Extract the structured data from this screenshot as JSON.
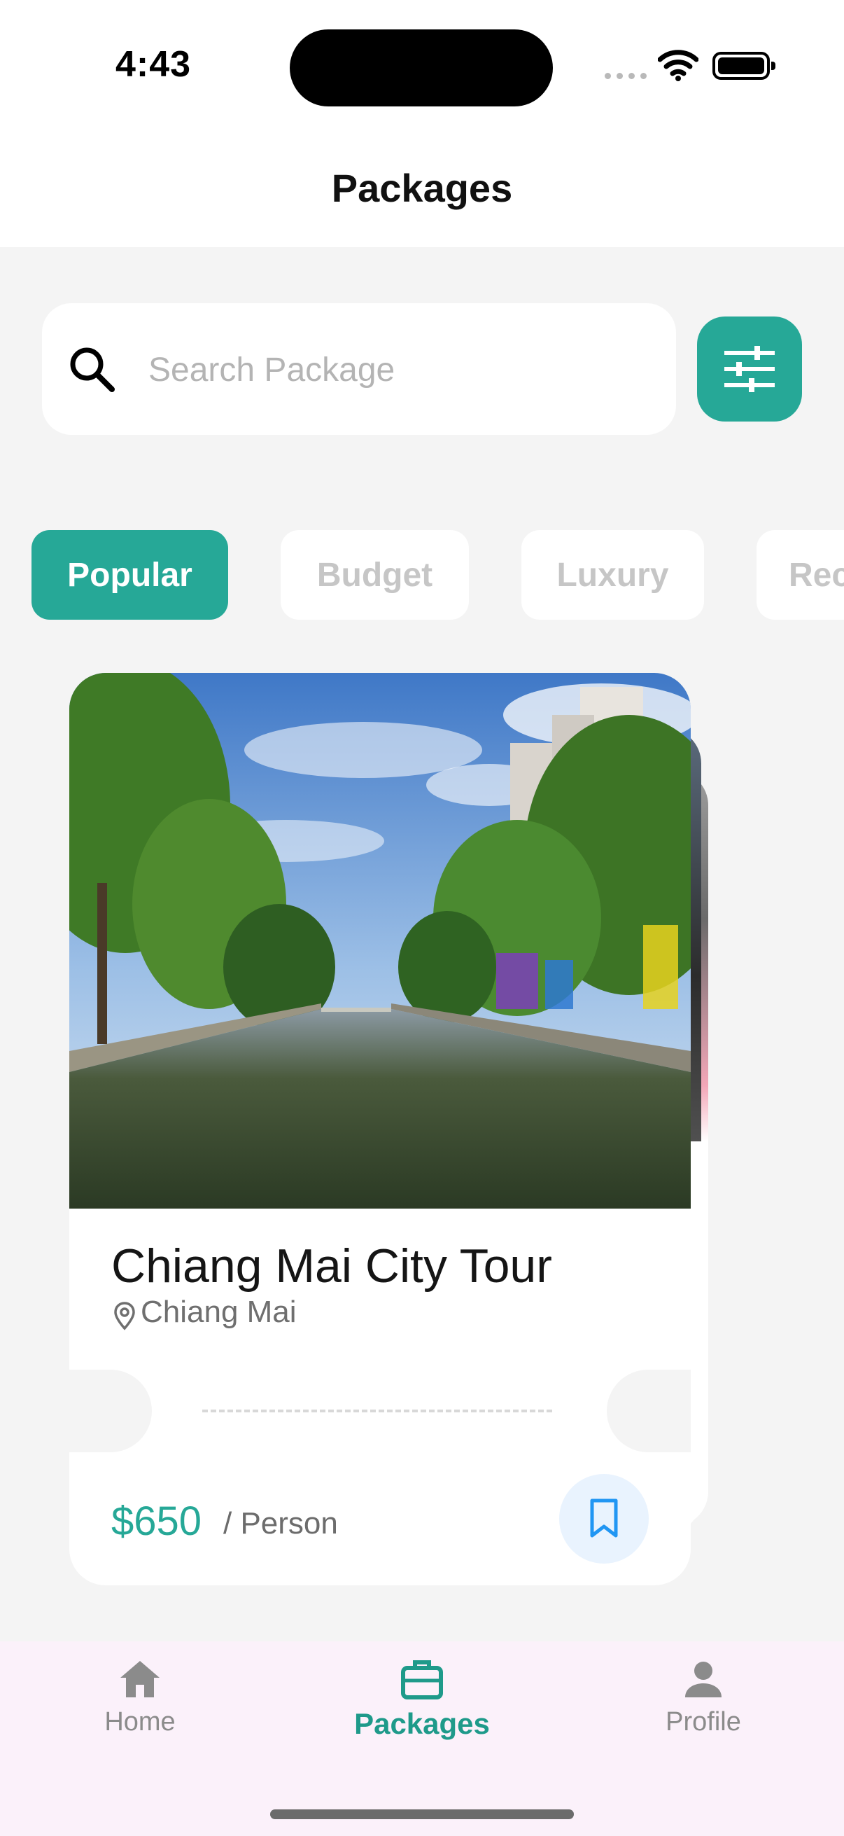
{
  "status_bar": {
    "time": "4:43"
  },
  "header": {
    "title": "Packages"
  },
  "search": {
    "placeholder": "Search Package"
  },
  "categories": [
    {
      "label": "Popular",
      "active": true
    },
    {
      "label": "Budget",
      "active": false
    },
    {
      "label": "Luxury",
      "active": false
    },
    {
      "label": "Rec",
      "active": false
    }
  ],
  "package_card": {
    "title": "Chiang Mai City Tour",
    "location": "Chiang Mai",
    "price": "$650",
    "price_unit": "/ Person"
  },
  "bottom_nav": [
    {
      "label": "Home",
      "icon": "home-icon",
      "active": false
    },
    {
      "label": "Packages",
      "icon": "briefcase-icon",
      "active": true
    },
    {
      "label": "Profile",
      "icon": "person-icon",
      "active": false
    }
  ],
  "colors": {
    "accent": "#26a897",
    "background": "#f4f4f4",
    "nav_background": "#fbf1fa",
    "bookmark_background": "#e9f3fe",
    "bookmark_icon": "#2196f3"
  }
}
